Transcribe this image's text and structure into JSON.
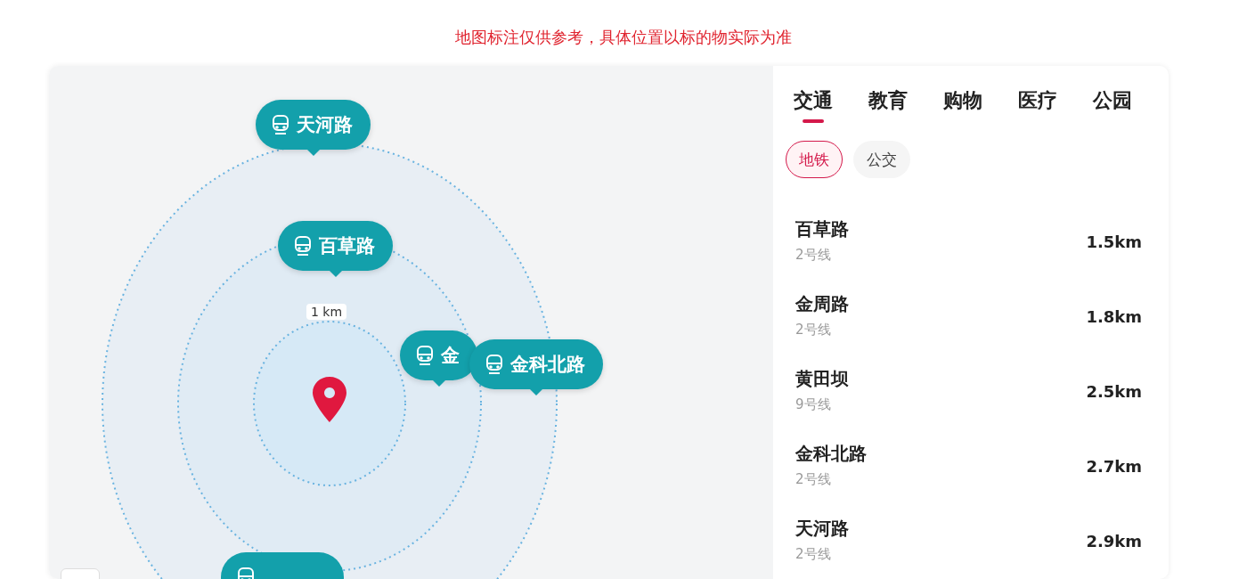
{
  "notice": "地图标注仅供参考，具体位置以标的物实际为准",
  "map": {
    "scale_label": "1 km",
    "markers": [
      {
        "name": "天河路"
      },
      {
        "name": "百草路"
      },
      {
        "name": "金"
      },
      {
        "name": "金科北路"
      }
    ]
  },
  "tabs": [
    {
      "label": "交通",
      "selected": true
    },
    {
      "label": "教育",
      "selected": false
    },
    {
      "label": "购物",
      "selected": false
    },
    {
      "label": "医疗",
      "selected": false
    },
    {
      "label": "公园",
      "selected": false
    }
  ],
  "chips": [
    {
      "label": "地铁",
      "selected": true
    },
    {
      "label": "公交",
      "selected": false
    }
  ],
  "stations": [
    {
      "name": "百草路",
      "line": "2号线",
      "distance": "1.5km"
    },
    {
      "name": "金周路",
      "line": "2号线",
      "distance": "1.8km"
    },
    {
      "name": "黄田坝",
      "line": "9号线",
      "distance": "2.5km"
    },
    {
      "name": "金科北路",
      "line": "2号线",
      "distance": "2.7km"
    },
    {
      "name": "天河路",
      "line": "2号线",
      "distance": "2.9km"
    }
  ]
}
